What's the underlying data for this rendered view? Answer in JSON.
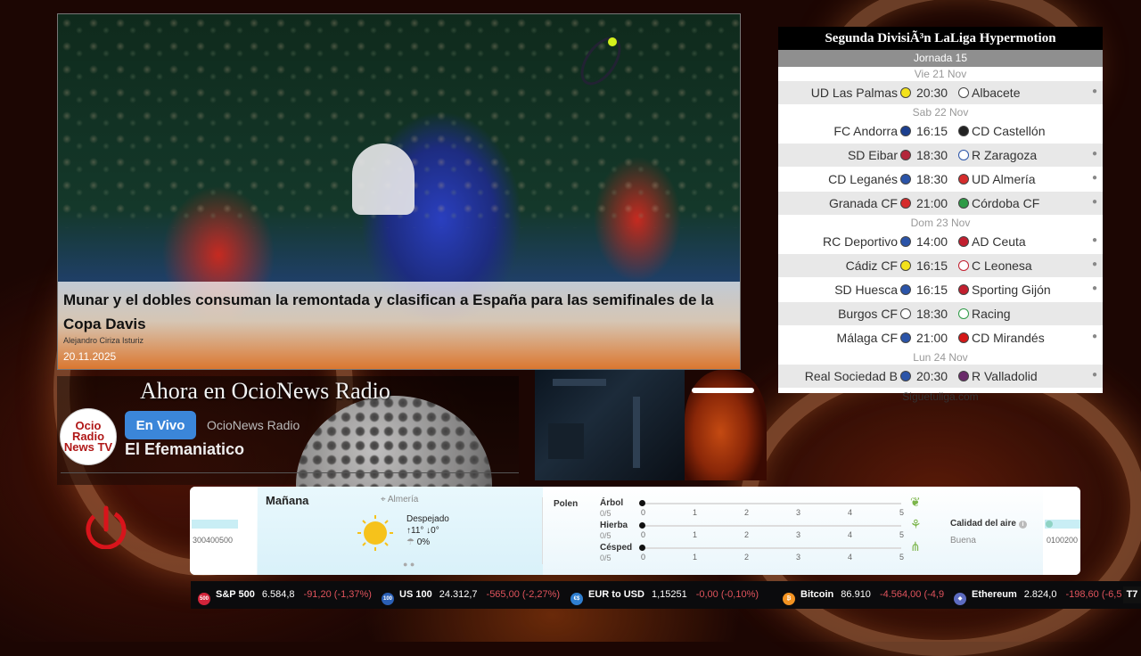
{
  "news": {
    "title": "Munar y el dobles consuman la remontada y clasifican a España para las semifinales de la Copa Davis",
    "author": "Alejandro Ciriza Isturiz",
    "date": "20.11.2025"
  },
  "radio": {
    "heading": "Ahora en OcioNews Radio",
    "logo_text": "Ocio Radio News TV",
    "live_label": "En Vivo",
    "station": "OcioNews Radio",
    "show": "El Efemaniatico"
  },
  "liga": {
    "title": "Segunda DivisiÃ³n LaLiga Hypermotion",
    "jornada": "Jornada 15",
    "days": [
      {
        "label": "Vie 21 Nov"
      },
      {
        "label": "Sab 22 Nov"
      },
      {
        "label": "Dom 23 Nov"
      },
      {
        "label": "Lun 24 Nov"
      }
    ],
    "matches": [
      {
        "home": "UD Las Palmas",
        "time": "20:30",
        "away": "Albacete"
      },
      {
        "home": "FC Andorra",
        "time": "16:15",
        "away": "CD Castellón"
      },
      {
        "home": "SD Eibar",
        "time": "18:30",
        "away": "R Zaragoza"
      },
      {
        "home": "CD Leganés",
        "time": "18:30",
        "away": "UD Almería"
      },
      {
        "home": "Granada CF",
        "time": "21:00",
        "away": "Córdoba CF"
      },
      {
        "home": "RC Deportivo",
        "time": "14:00",
        "away": "AD Ceuta"
      },
      {
        "home": "Cádiz CF",
        "time": "16:15",
        "away": "C Leonesa"
      },
      {
        "home": "SD Huesca",
        "time": "16:15",
        "away": "Sporting Gijón"
      },
      {
        "home": "Burgos CF",
        "time": "18:30",
        "away": "Racing"
      },
      {
        "home": "Málaga CF",
        "time": "21:00",
        "away": "CD Mirandés"
      },
      {
        "home": "Real Sociedad B",
        "time": "20:30",
        "away": "R Valladolid"
      }
    ],
    "footer": "Siguetuliga.com"
  },
  "weather": {
    "left_nums": "300400500",
    "title": "Mañana",
    "location": "Almería",
    "condition": "Despejado",
    "temp_high": "11°",
    "temp_low": "0°",
    "rain": "0%",
    "pollen_label": "Polen",
    "pollen": [
      {
        "name": "Árbol",
        "value": "0/5",
        "level": 0
      },
      {
        "name": "Hierba",
        "value": "0/5",
        "level": 0
      },
      {
        "name": "Césped",
        "value": "0/5",
        "level": 0
      }
    ],
    "pollen_ticks": [
      "0",
      "1",
      "2",
      "3",
      "4",
      "5"
    ],
    "air_label": "Calidad del aire",
    "air_status": "Buena",
    "right_nums": "0100200"
  },
  "ticker": [
    {
      "icon_text": "500",
      "icon_color": "#d2243a",
      "name": "S&P 500",
      "price": "6.584,8",
      "change": "-91,20 (-1,37%)"
    },
    {
      "icon_text": "100",
      "icon_color": "#2a5fb5",
      "name": "US 100",
      "price": "24.312,7",
      "change": "-565,00 (-2,27%)"
    },
    {
      "icon_text": "€$",
      "icon_color": "#2f7fd1",
      "name": "EUR to USD",
      "price": "1,15251",
      "change": "-0,00 (-0,10%)"
    },
    {
      "icon_text": "₿",
      "icon_color": "#f39321",
      "name": "Bitcoin",
      "price": "86.910",
      "change": "-4.564,00 (-4,9"
    },
    {
      "icon_text": "◆",
      "icon_color": "#5c6bc0",
      "name": "Ethereum",
      "price": "2.824,0",
      "change": "-198,60 (-6,5"
    }
  ],
  "ticker_end": "T7"
}
